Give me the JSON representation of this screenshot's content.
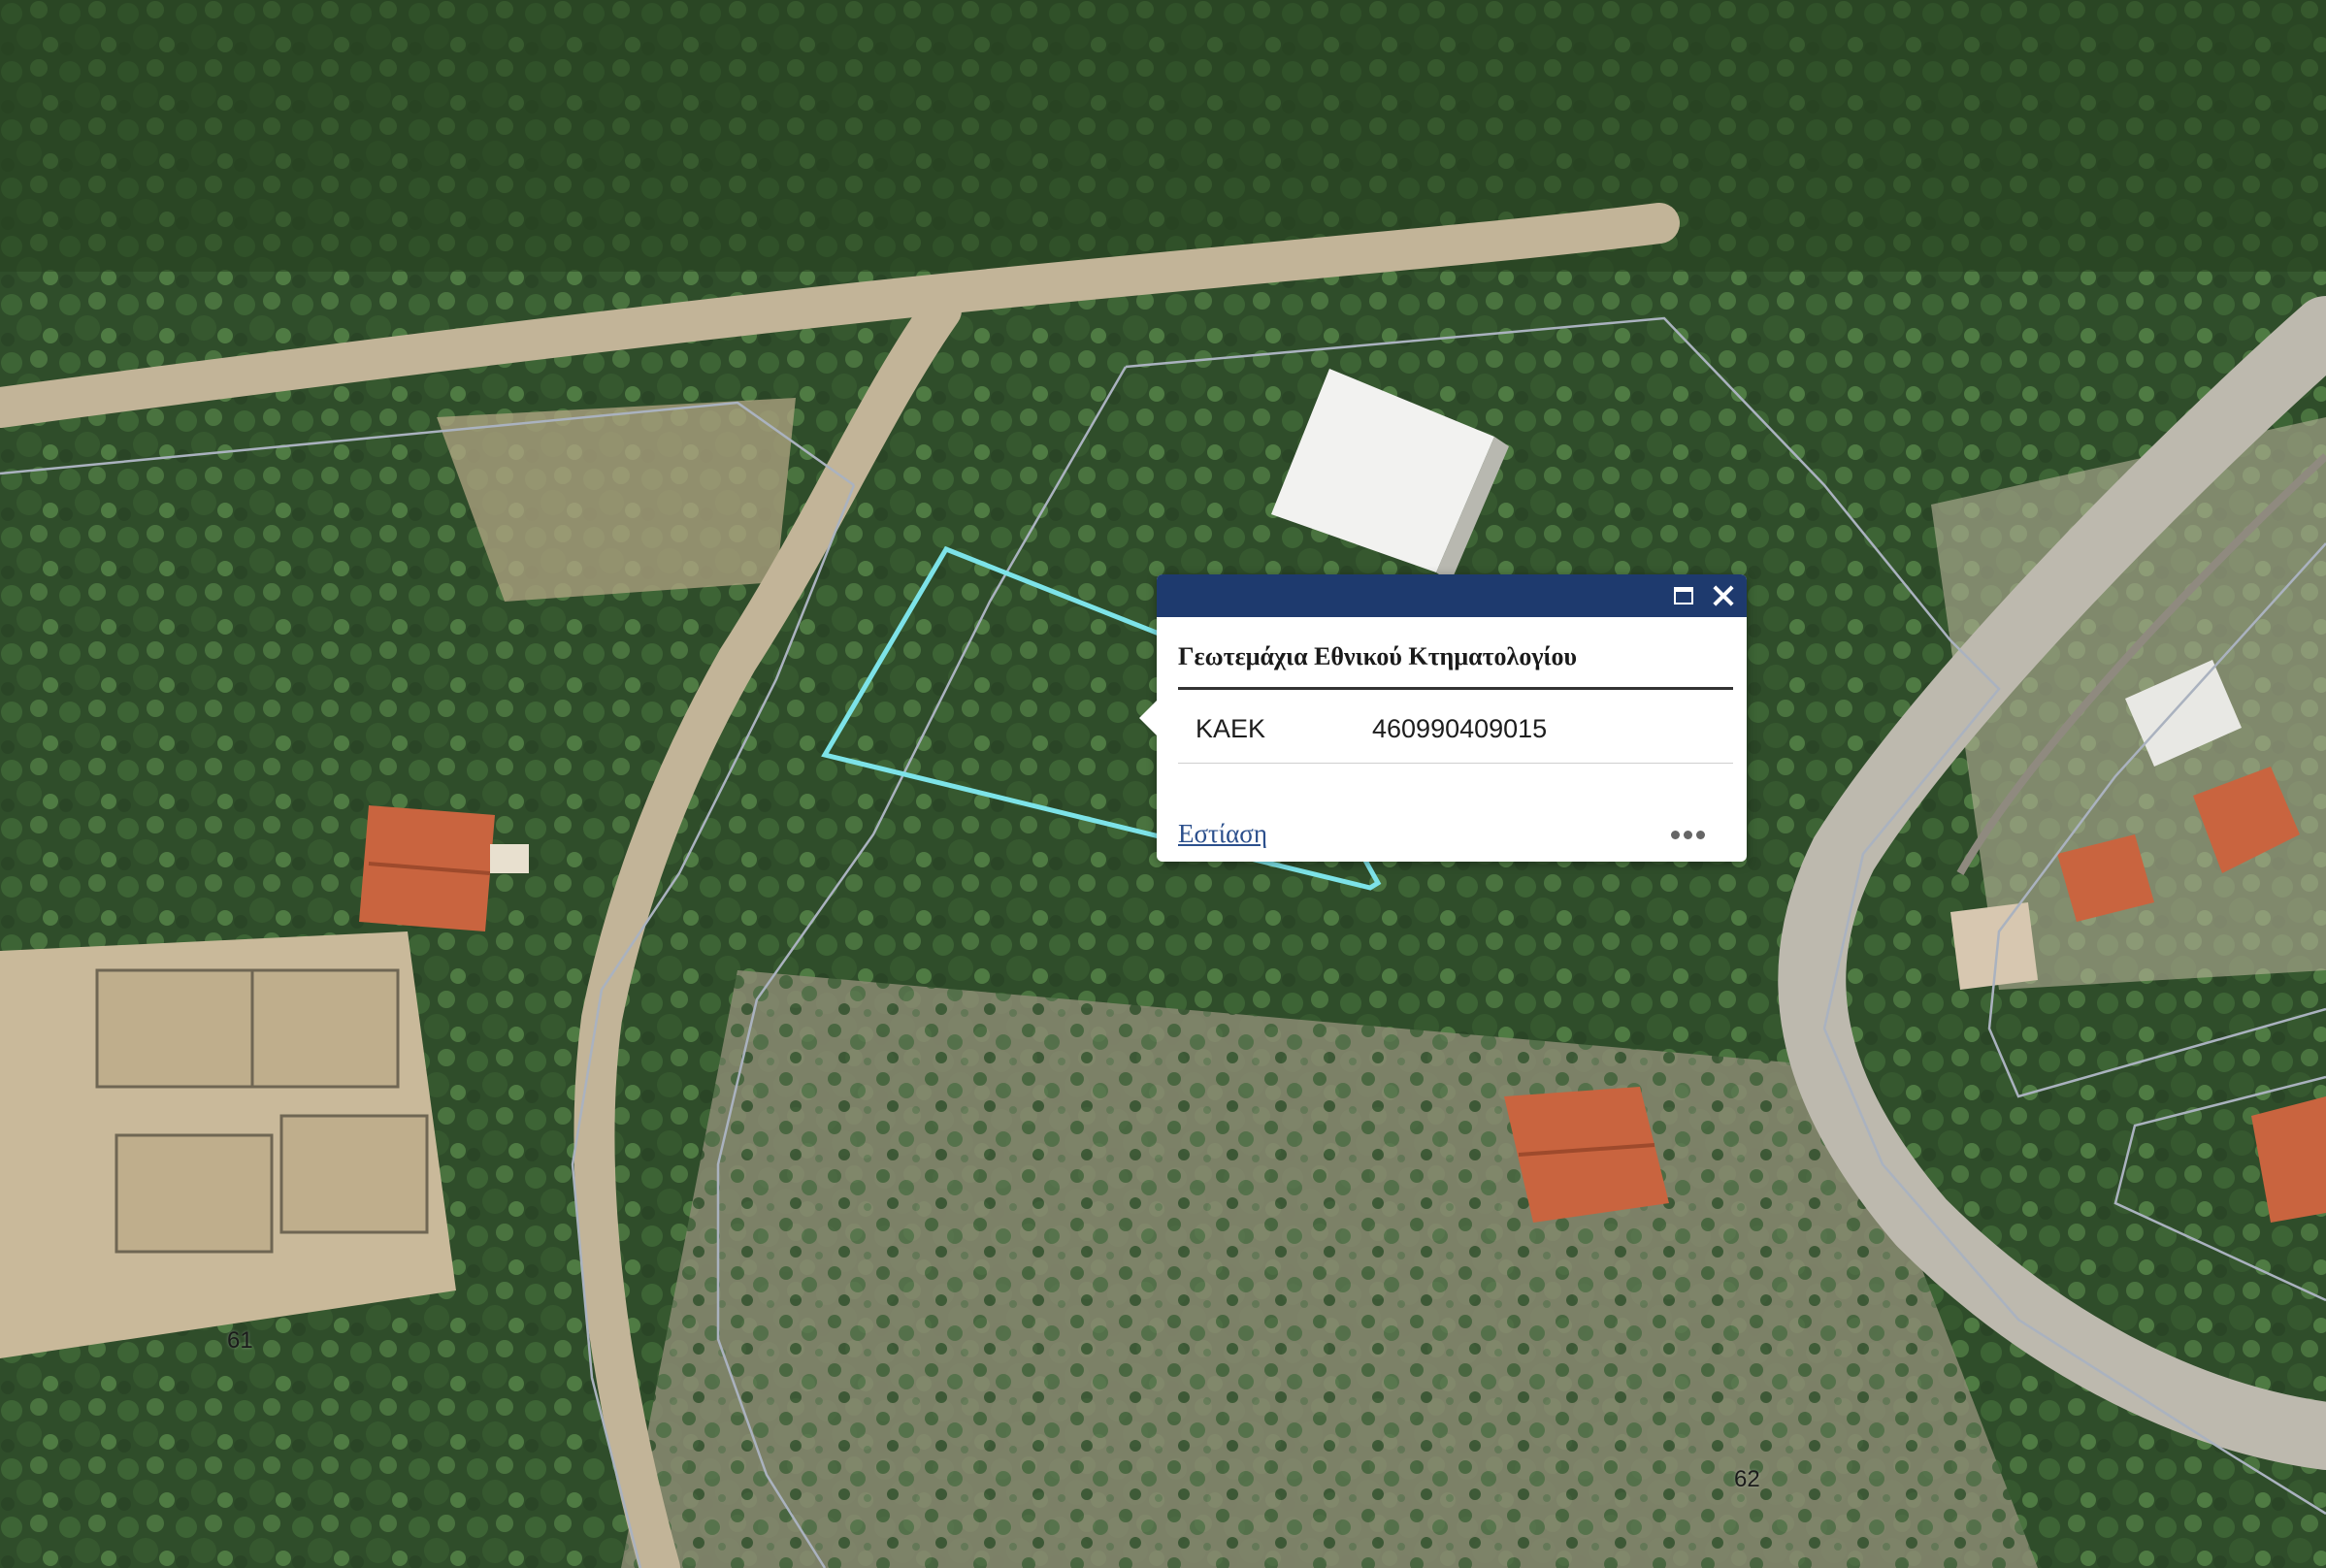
{
  "map": {
    "parcel_labels": [
      "61",
      "62"
    ],
    "highlight_color": "#7de3e8",
    "parcel_line_color": "#aab2bf"
  },
  "popup": {
    "header_color": "#1e3a6e",
    "title": "Γεωτεμάχια Εθνικού Κτηματολογίου",
    "attribute_key": "ΚΑΕΚ",
    "attribute_value": "460990409015",
    "zoom_link": "Εστίαση",
    "more_icon": "more-horizontal-icon",
    "maximize_icon": "maximize-icon",
    "close_icon": "close-icon"
  }
}
